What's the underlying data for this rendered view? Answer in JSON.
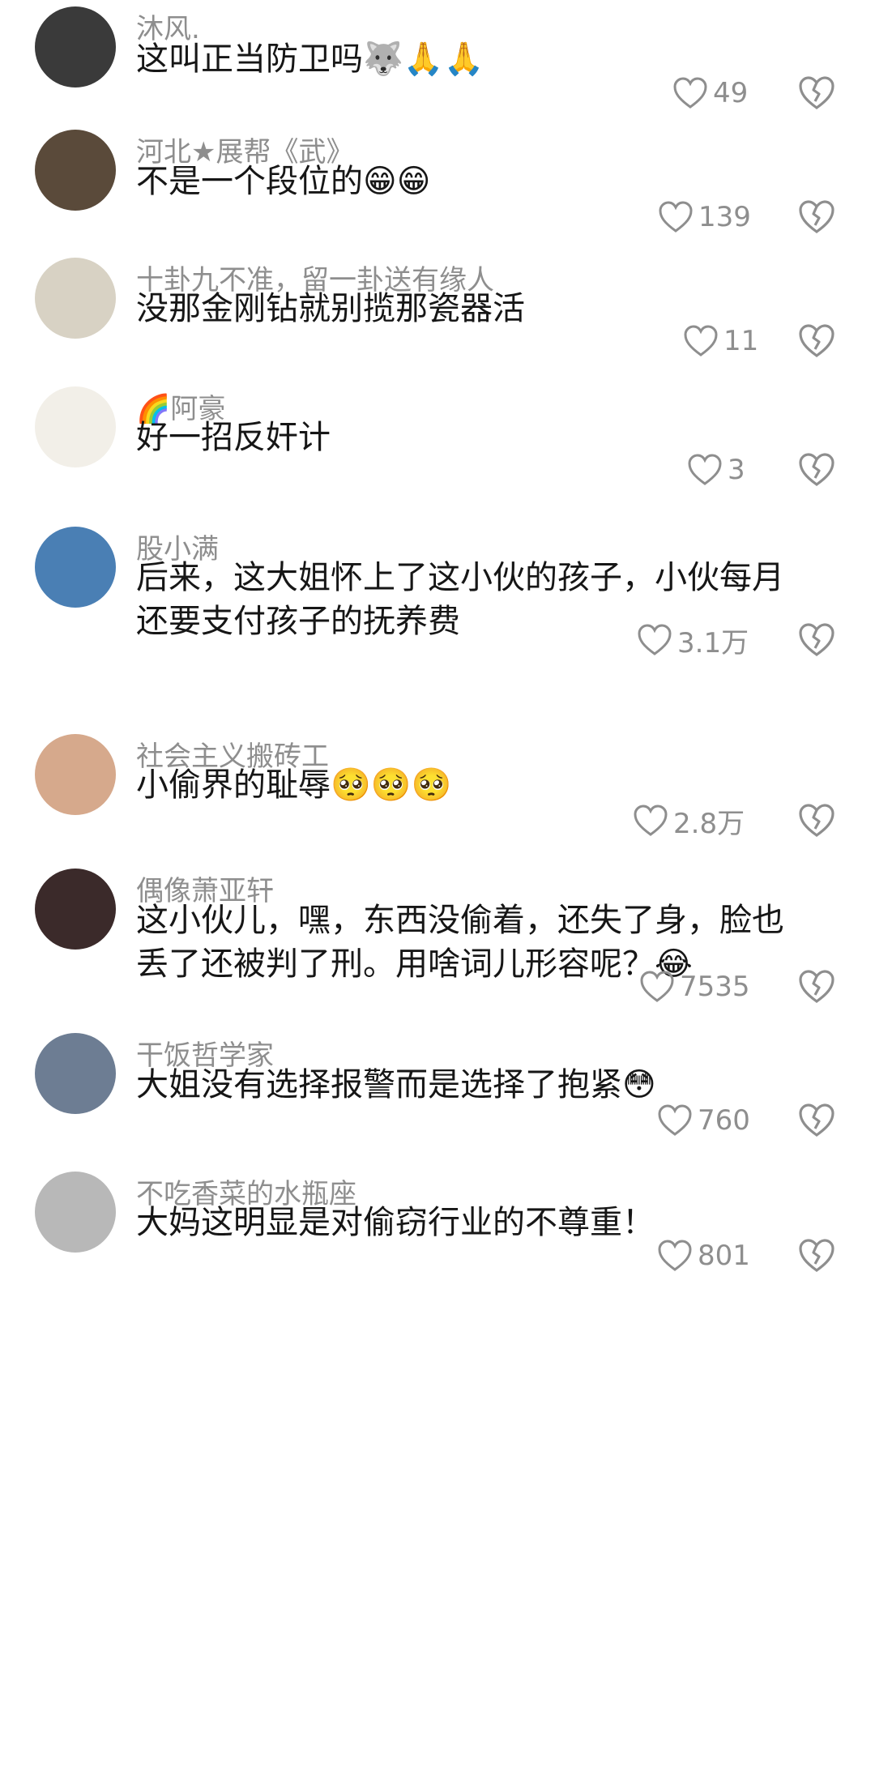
{
  "comments": [
    {
      "username": "沐风.",
      "text": "这叫正当防卫吗",
      "emojis": "🐺🙏🙏",
      "likes": "49"
    },
    {
      "username": "河北★展帮《武》",
      "text": "不是一个段位的",
      "emojis": "😁😁",
      "likes": "139"
    },
    {
      "username": "十卦九不准，留一卦送有缘人",
      "text": "没那金刚钻就别揽那瓷器活",
      "emojis": "",
      "likes": "11"
    },
    {
      "username": "🌈阿豪",
      "text": "好一招反奸计",
      "emojis": "",
      "likes": "3"
    },
    {
      "username": "股小满",
      "text": "后来，这大姐怀上了这小伙的孩子，小伙每月\n还要支付孩子的抚养费",
      "emojis": "",
      "likes": "3.1万"
    },
    {
      "username": "社会主义搬砖工",
      "text": "小偷界的耻辱",
      "emojis": "🥺🥺🥺",
      "likes": "2.8万"
    },
    {
      "username": "偶像萧亚轩",
      "text": "这小伙儿，嘿，东西没偷着，还失了身，脸也\n丢了还被判了刑。用啥词儿形容呢？",
      "emojis": "😂",
      "likes": "7535"
    },
    {
      "username": "干饭哲学家",
      "text": "大姐没有选择报警而是选择了抱紧",
      "emojis": "😳",
      "likes": "760"
    },
    {
      "username": "不吃香菜的水瓶座",
      "text": "大妈这明显是对偷窃行业的不尊重！",
      "emojis": "",
      "likes": "801"
    }
  ],
  "colors": {
    "muted": "#8e8e8e",
    "text": "#161616",
    "background": "#ffffff"
  },
  "icons": {
    "like": "heart-outline-icon",
    "dislike": "broken-heart-icon"
  }
}
